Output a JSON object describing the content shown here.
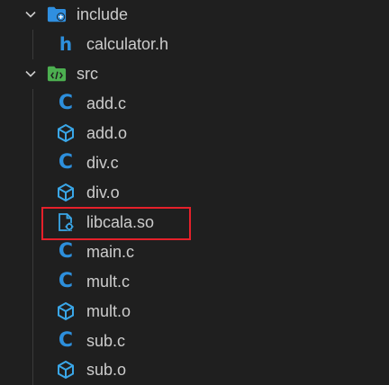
{
  "explorer": {
    "include": {
      "name": "include",
      "icon": "folder-include-icon",
      "expanded": true
    },
    "calculator_h": {
      "name": "calculator.h",
      "icon": "c-header-file-icon"
    },
    "src": {
      "name": "src",
      "icon": "folder-src-icon",
      "expanded": true
    },
    "files": [
      {
        "name": "add.c",
        "icon": "c-file-icon"
      },
      {
        "name": "add.o",
        "icon": "object-file-icon"
      },
      {
        "name": "div.c",
        "icon": "c-file-icon"
      },
      {
        "name": "div.o",
        "icon": "object-file-icon"
      },
      {
        "name": "libcala.so",
        "icon": "shared-library-icon",
        "highlighted": true
      },
      {
        "name": "main.c",
        "icon": "c-file-icon"
      },
      {
        "name": "mult.c",
        "icon": "c-file-icon"
      },
      {
        "name": "mult.o",
        "icon": "object-file-icon"
      },
      {
        "name": "sub.c",
        "icon": "c-file-icon"
      },
      {
        "name": "sub.o",
        "icon": "object-file-icon"
      }
    ]
  },
  "colors": {
    "background": "#1f1f1f",
    "text": "#cccccc",
    "c_icon": "#2d8fdc",
    "object_icon": "#3aa7e8",
    "folder_include": "#2f8fe0",
    "folder_src": "#4caf50",
    "highlight_border": "#e5202a"
  }
}
